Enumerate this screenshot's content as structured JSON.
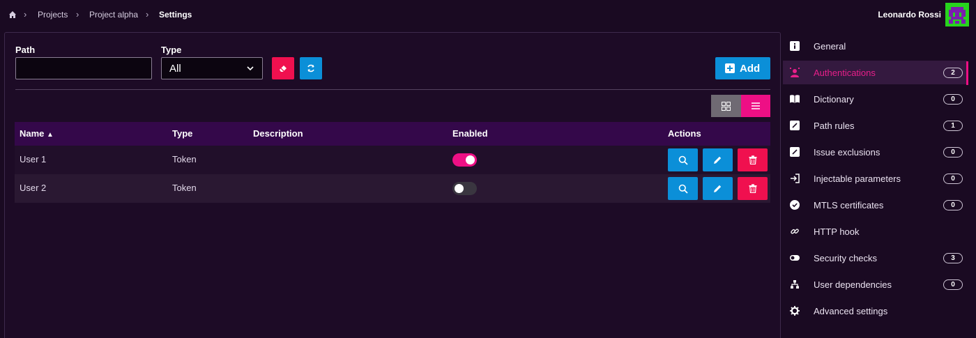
{
  "breadcrumb": {
    "items": [
      "Projects",
      "Project alpha",
      "Settings"
    ]
  },
  "user": {
    "name": "Leonardo Rossi"
  },
  "filters": {
    "path_label": "Path",
    "path_value": "",
    "type_label": "Type",
    "type_value": "All"
  },
  "toolbar": {
    "add_label": "Add"
  },
  "table": {
    "columns": [
      "Name",
      "Type",
      "Description",
      "Enabled",
      "Actions"
    ],
    "sort_indicator": "▲",
    "rows": [
      {
        "name": "User 1",
        "type": "Token",
        "description": "",
        "enabled": true
      },
      {
        "name": "User 2",
        "type": "Token",
        "description": "",
        "enabled": false
      }
    ]
  },
  "sidebar": {
    "items": [
      {
        "label": "General",
        "icon": "info-icon",
        "badge": ""
      },
      {
        "label": "Authentications",
        "icon": "user-badge-icon",
        "badge": "2",
        "active": true
      },
      {
        "label": "Dictionary",
        "icon": "book-icon",
        "badge": "0"
      },
      {
        "label": "Path rules",
        "icon": "slash-box-icon",
        "badge": "1"
      },
      {
        "label": "Issue exclusions",
        "icon": "slash-box-icon",
        "badge": "0"
      },
      {
        "label": "Injectable parameters",
        "icon": "sign-in-icon",
        "badge": "0"
      },
      {
        "label": "MTLS certificates",
        "icon": "certificate-icon",
        "badge": "0"
      },
      {
        "label": "HTTP hook",
        "icon": "link-icon",
        "badge": ""
      },
      {
        "label": "Security checks",
        "icon": "toggle-icon",
        "badge": "3"
      },
      {
        "label": "User dependencies",
        "icon": "sitemap-icon",
        "badge": "0"
      },
      {
        "label": "Advanced settings",
        "icon": "gear-icon",
        "badge": ""
      }
    ]
  },
  "colors": {
    "accent_pink": "#ee0f85",
    "accent_blue": "#0b8fd8",
    "danger_red": "#f0104f",
    "background": "#1a0a22",
    "header_purple": "#34084a"
  }
}
